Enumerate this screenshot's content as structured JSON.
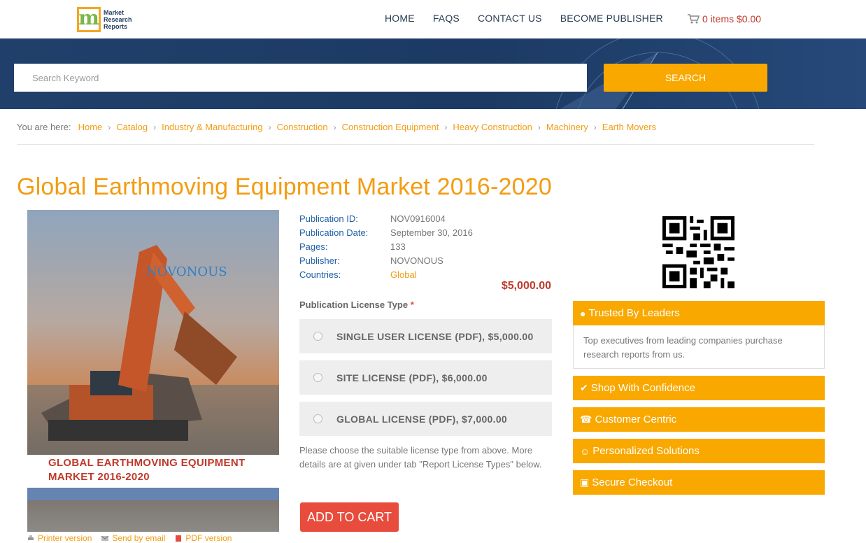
{
  "header": {
    "logo_text": [
      "Market",
      "Research",
      "Reports"
    ],
    "logo_letter": "m",
    "nav": [
      "HOME",
      "FAQS",
      "CONTACT US",
      "BECOME PUBLISHER"
    ],
    "cart_text": "0 items $0.00"
  },
  "search": {
    "placeholder": "Search Keyword",
    "button_label": "SEARCH"
  },
  "breadcrumb": {
    "lead": "You are here:",
    "items": [
      "Home",
      "Catalog",
      "Industry & Manufacturing",
      "Construction",
      "Construction Equipment",
      "Heavy Construction",
      "Machinery",
      "Earth Movers"
    ],
    "separator": "›"
  },
  "title": "Global Earthmoving Equipment Market 2016-2020",
  "cover": {
    "brand": "NOVONOUS",
    "title_line1": "GLOBAL EARTHMOVING EQUIPMENT",
    "title_line2": "MARKET 2016-2020"
  },
  "details": {
    "publication_id_label": "Publication ID:",
    "publication_id": "NOV0916004",
    "publication_date_label": "Publication Date:",
    "publication_date": "September 30, 2016",
    "pages_label": "Pages:",
    "pages": "133",
    "publisher_label": "Publisher:",
    "publisher": "NOVONOUS",
    "countries_label": "Countries:",
    "countries": "Global"
  },
  "price": "$5,000.00",
  "license": {
    "label": "Publication License Type",
    "required_mark": "*",
    "options": [
      "SINGLE USER LICENSE (PDF), $5,000.00",
      "SITE LICENSE (PDF), $6,000.00",
      "GLOBAL LICENSE (PDF), $7,000.00"
    ],
    "note": "Please choose the suitable license type from above. More details are at given under tab \"Report License Types\" below."
  },
  "add_to_cart": "ADD TO CART",
  "links": [
    "Printer version",
    "Send by email",
    "PDF version"
  ],
  "sidebar": {
    "trusted_title": "Trusted By Leaders",
    "trusted_body": "Top executives from leading companies purchase research reports from us.",
    "panels": [
      "Shop With Confidence",
      "Customer Centric",
      "Personalized Solutions",
      "Secure Checkout"
    ]
  },
  "colors": {
    "accent": "#f39c12",
    "panel": "#f9a800",
    "cta": "#e74c3c",
    "price": "#c0392b",
    "banner": "#1c3a63"
  }
}
